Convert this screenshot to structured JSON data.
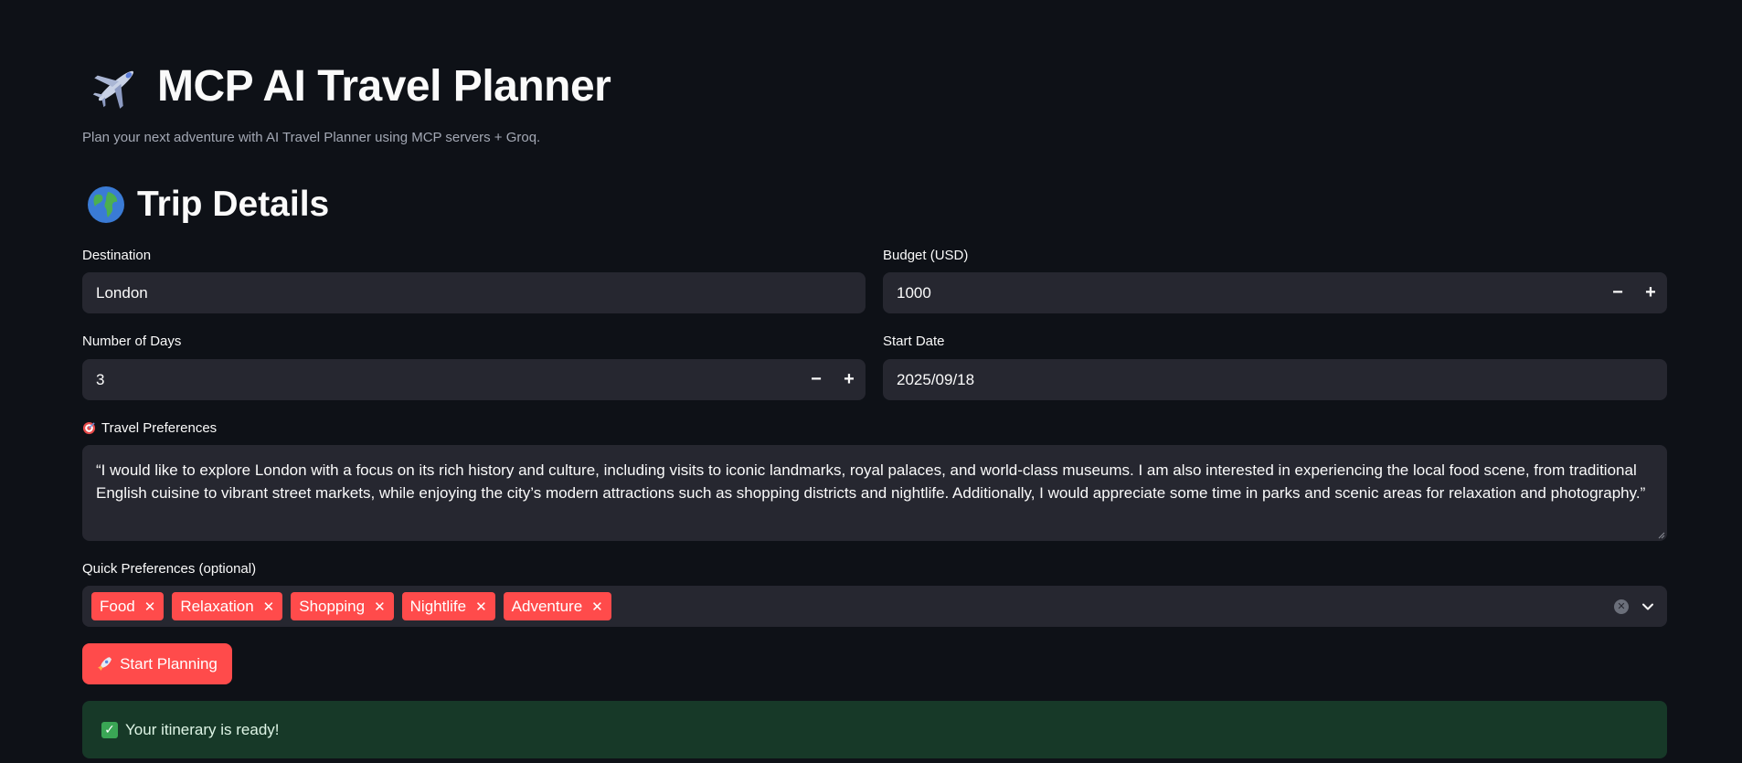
{
  "header": {
    "icon": "airplane-icon",
    "title": "MCP AI Travel Planner",
    "subtitle": "Plan your next adventure with AI Travel Planner using MCP servers + Groq."
  },
  "section": {
    "icon": "globe-icon",
    "title": "Trip Details"
  },
  "form": {
    "destination": {
      "label": "Destination",
      "value": "London"
    },
    "budget": {
      "label": "Budget (USD)",
      "value": "1000",
      "minus": "−",
      "plus": "+"
    },
    "days": {
      "label": "Number of Days",
      "value": "3",
      "minus": "−",
      "plus": "+"
    },
    "start_date": {
      "label": "Start Date",
      "value": "2025/09/18"
    },
    "preferences": {
      "icon": "target-icon",
      "label": "Travel Preferences",
      "value": "“I would like to explore London with a focus on its rich history and culture, including visits to iconic landmarks, royal palaces, and world-class museums. I am also interested in experiencing the local food scene, from traditional English cuisine to vibrant street markets, while enjoying the city’s modern attractions such as shopping districts and nightlife. Additionally, I would appreciate some time in parks and scenic areas for relaxation and photography.”"
    },
    "quick_prefs": {
      "label": "Quick Preferences (optional)",
      "tags": [
        "Food",
        "Relaxation",
        "Shopping",
        "Nightlife",
        "Adventure"
      ],
      "remove_glyph": "✕"
    }
  },
  "actions": {
    "start": {
      "icon": "rocket-icon",
      "label": "Start Planning"
    }
  },
  "status": {
    "icon": "check-icon",
    "message": "Your itinerary is ready!"
  },
  "colors": {
    "background": "#0e1117",
    "input_bg": "#262730",
    "accent": "#ff4b4b",
    "success_bg": "#173928"
  }
}
